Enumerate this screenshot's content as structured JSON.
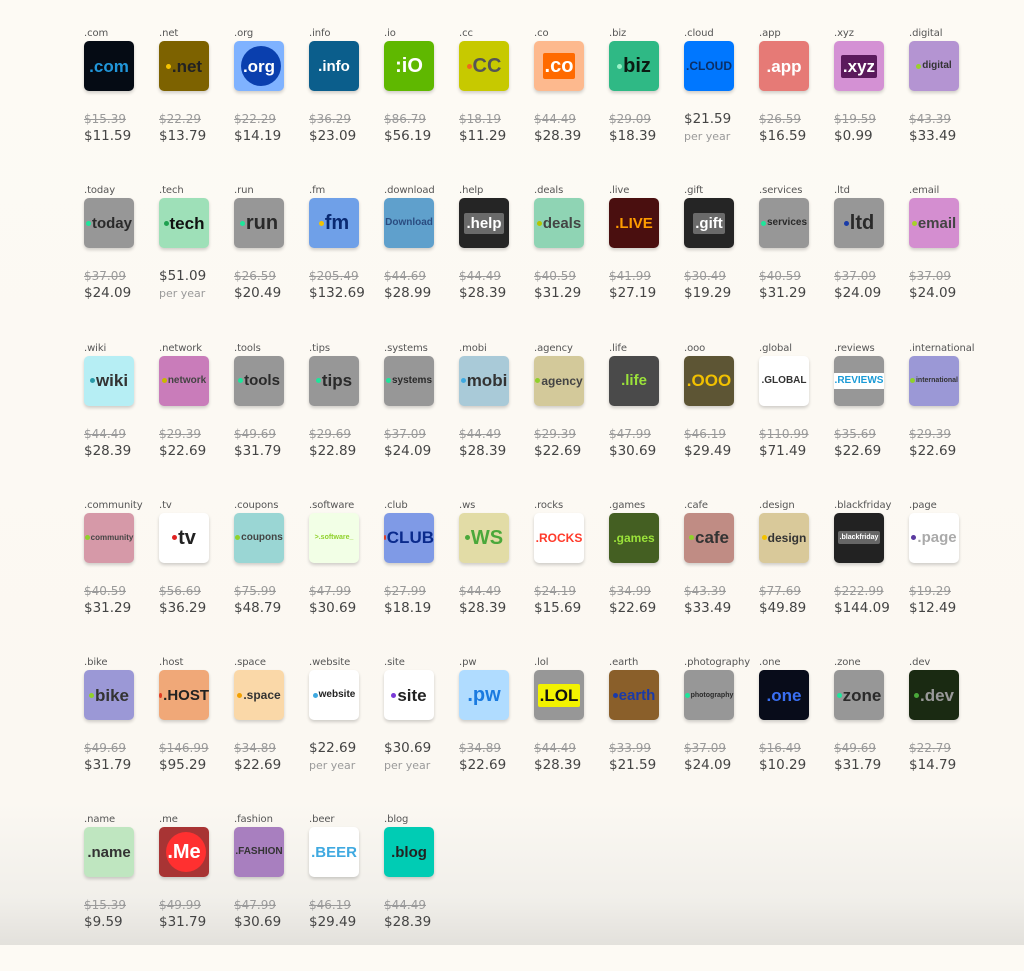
{
  "domains": [
    {
      "tld": ".com",
      "tile_text": ".com",
      "bg": "#050b14",
      "fg": "#2196d9",
      "old": "$15.39",
      "new": "$11.59"
    },
    {
      "tld": ".net",
      "tile_text": ".net",
      "bg": "#7d6200",
      "fg": "#222222",
      "dot": "#f5c400",
      "old": "$22.29",
      "new": "$13.79"
    },
    {
      "tld": ".org",
      "tile_text": ".org",
      "bg": "#7fb2ff",
      "fg": "#ffffff",
      "circle": "#0a3fae",
      "old": "$22.29",
      "new": "$14.19"
    },
    {
      "tld": ".info",
      "tile_text": ".info",
      "bg": "#0b5e8c",
      "fg": "#ffffff",
      "old": "$36.29",
      "new": "$23.09"
    },
    {
      "tld": ".io",
      "tile_text": ":iO",
      "bg": "#5fb800",
      "fg": "#ffffff",
      "old": "$86.79",
      "new": "$56.19"
    },
    {
      "tld": ".cc",
      "tile_text": "CC",
      "bg": "#c7c900",
      "fg": "#555555",
      "dot": "#ee6a1b",
      "old": "$18.19",
      "new": "$11.29"
    },
    {
      "tld": ".co",
      "tile_text": ".co",
      "bg": "#fdb98e",
      "fg": "#ffffff",
      "inner": "#ff6a00",
      "old": "$44.49",
      "new": "$28.39"
    },
    {
      "tld": ".biz",
      "tile_text": "biz",
      "bg": "#2fb985",
      "fg": "#0b1b12",
      "dot": "#9af2c8",
      "old": "$29.09",
      "new": "$18.39"
    },
    {
      "tld": ".cloud",
      "tile_text": ".CLOUD",
      "bg": "#0077ff",
      "fg": "#0b2f66",
      "price": "$21.59",
      "per_year": "per year"
    },
    {
      "tld": ".app",
      "tile_text": ".app",
      "bg": "#e67a76",
      "fg": "#ffffff",
      "old": "$26.59",
      "new": "$16.59"
    },
    {
      "tld": ".xyz",
      "tile_text": ".xyz",
      "bg": "#d491d4",
      "fg": "#ffffff",
      "inner": "#5a1a5c",
      "old": "$19.59",
      "new": "$0.99"
    },
    {
      "tld": ".digital",
      "tile_text": "digital",
      "bg": "#b494d2",
      "fg": "#333333",
      "dot": "#9ad12b",
      "old": "$43.39",
      "new": "$33.49"
    },
    {
      "tld": ".today",
      "tile_text": "today",
      "bg": "#979797",
      "fg": "#2a2a2a",
      "dot": "#1ee59b",
      "old": "$37.09",
      "new": "$24.09"
    },
    {
      "tld": ".tech",
      "tile_text": "tech",
      "bg": "#9ee0b8",
      "fg": "#111111",
      "dot": "#1fa050",
      "price": "$51.09",
      "per_year": "per year"
    },
    {
      "tld": ".run",
      "tile_text": "run",
      "bg": "#979797",
      "fg": "#2a2a2a",
      "dot": "#1ee59b",
      "old": "$26.59",
      "new": "$20.49"
    },
    {
      "tld": ".fm",
      "tile_text": "fm",
      "bg": "#6fa0e8",
      "fg": "#0a2a73",
      "dot": "#f2c200",
      "old": "$205.49",
      "new": "$132.69"
    },
    {
      "tld": ".download",
      "tile_text": "Download",
      "bg": "#5fa0cc",
      "fg": "#2a4c80",
      "old": "$44.69",
      "new": "$28.99"
    },
    {
      "tld": ".help",
      "tile_text": ".help",
      "bg": "#252525",
      "fg": "#ffffff",
      "inner": "#6a6a6a",
      "old": "$44.49",
      "new": "$28.39"
    },
    {
      "tld": ".deals",
      "tile_text": "deals",
      "bg": "#8fd4b4",
      "fg": "#444444",
      "dot": "#b5c600",
      "old": "$40.59",
      "new": "$31.29"
    },
    {
      "tld": ".live",
      "tile_text": ".LIVE",
      "bg": "#4a0f0f",
      "fg": "#ff9d00",
      "old": "$41.99",
      "new": "$27.19"
    },
    {
      "tld": ".gift",
      "tile_text": ".gift",
      "bg": "#252525",
      "fg": "#ffffff",
      "inner": "#6a6a6a",
      "old": "$30.49",
      "new": "$19.29"
    },
    {
      "tld": ".services",
      "tile_text": "services",
      "bg": "#979797",
      "fg": "#2a2a2a",
      "dot": "#1ee59b",
      "old": "$40.59",
      "new": "$31.29"
    },
    {
      "tld": ".ltd",
      "tile_text": "ltd",
      "bg": "#979797",
      "fg": "#2a2a2a",
      "dot": "#1a3ca8",
      "old": "$37.09",
      "new": "$24.09"
    },
    {
      "tld": ".email",
      "tile_text": "email",
      "bg": "#d48ed0",
      "fg": "#444444",
      "dot": "#a6d12b",
      "old": "$37.09",
      "new": "$24.09"
    },
    {
      "tld": ".wiki",
      "tile_text": "wiki",
      "bg": "#b6eef4",
      "fg": "#333333",
      "dot": "#2a9aa8",
      "old": "$44.49",
      "new": "$28.39"
    },
    {
      "tld": ".network",
      "tile_text": "network",
      "bg": "#c97cba",
      "fg": "#444444",
      "dot": "#c9b800",
      "old": "$29.39",
      "new": "$22.69"
    },
    {
      "tld": ".tools",
      "tile_text": "tools",
      "bg": "#979797",
      "fg": "#2a2a2a",
      "dot": "#1ee59b",
      "old": "$49.69",
      "new": "$31.79"
    },
    {
      "tld": ".tips",
      "tile_text": "tips",
      "bg": "#979797",
      "fg": "#2a2a2a",
      "dot": "#1ee59b",
      "old": "$29.69",
      "new": "$22.89"
    },
    {
      "tld": ".systems",
      "tile_text": "systems",
      "bg": "#979797",
      "fg": "#2a2a2a",
      "dot": "#1ee59b",
      "old": "$37.09",
      "new": "$24.09"
    },
    {
      "tld": ".mobi",
      "tile_text": "mobi",
      "bg": "#a9cad8",
      "fg": "#333333",
      "dot": "#3fa9e0",
      "old": "$44.49",
      "new": "$28.39"
    },
    {
      "tld": ".agency",
      "tile_text": "agency",
      "bg": "#d3c99a",
      "fg": "#444444",
      "dot": "#8fd12b",
      "old": "$29.39",
      "new": "$22.69"
    },
    {
      "tld": ".life",
      "tile_text": ".life",
      "bg": "#4a4a4a",
      "fg": "#9be23a",
      "old": "$47.99",
      "new": "$30.69"
    },
    {
      "tld": ".ooo",
      "tile_text": ".OOO",
      "bg": "#5d5534",
      "fg": "#f1c000",
      "old": "$46.19",
      "new": "$29.49"
    },
    {
      "tld": ".global",
      "tile_text": ".GLOBAL",
      "bg": "#ffffff",
      "fg": "#333333",
      "old": "$110.99",
      "new": "$71.49"
    },
    {
      "tld": ".reviews",
      "tile_text": ".REVIEWS",
      "bg": "#979797",
      "fg": "#1a9ad6",
      "inner": "#ffffff",
      "old": "$35.69",
      "new": "$22.69"
    },
    {
      "tld": ".international",
      "tile_text": "international",
      "bg": "#9b98d6",
      "fg": "#333333",
      "dot": "#8fd12b",
      "old": "$29.39",
      "new": "$22.69"
    },
    {
      "tld": ".community",
      "tile_text": "community",
      "bg": "#d699a8",
      "fg": "#444444",
      "dot": "#8fd12b",
      "old": "$40.59",
      "new": "$31.29"
    },
    {
      "tld": ".tv",
      "tile_text": "tv",
      "bg": "#ffffff",
      "fg": "#222222",
      "dot": "#e02222",
      "old": "$56.69",
      "new": "$36.29"
    },
    {
      "tld": ".coupons",
      "tile_text": "coupons",
      "bg": "#9ad6d4",
      "fg": "#444444",
      "dot": "#8fd12b",
      "old": "$75.99",
      "new": "$48.79"
    },
    {
      "tld": ".software",
      "tile_text": ">.software_",
      "bg": "#f2ffe6",
      "fg": "#8fd12b",
      "old": "$47.99",
      "new": "$30.69"
    },
    {
      "tld": ".club",
      "tile_text": "CLUB",
      "bg": "#7f9ae6",
      "fg": "#0a2a8c",
      "dot": "#e03a22",
      "old": "$27.99",
      "new": "$18.19"
    },
    {
      "tld": ".ws",
      "tile_text": "WS",
      "bg": "#e2dca6",
      "fg": "#4aa83a",
      "dot": "#4aa83a",
      "old": "$44.49",
      "new": "$28.39"
    },
    {
      "tld": ".rocks",
      "tile_text": ".ROCKS",
      "bg": "#ffffff",
      "fg": "#ff3a2a",
      "old": "$24.19",
      "new": "$15.69"
    },
    {
      "tld": ".games",
      "tile_text": ".games",
      "bg": "#445f22",
      "fg": "#9be23a",
      "old": "$34.99",
      "new": "$22.69"
    },
    {
      "tld": ".cafe",
      "tile_text": "cafe",
      "bg": "#c08c84",
      "fg": "#333333",
      "dot": "#8fd12b",
      "old": "$43.39",
      "new": "$33.49"
    },
    {
      "tld": ".design",
      "tile_text": "design",
      "bg": "#d9c99a",
      "fg": "#333333",
      "dot": "#f2c200",
      "old": "$77.69",
      "new": "$49.89"
    },
    {
      "tld": ".blackfriday",
      "tile_text": ".blackfriday",
      "bg": "#222222",
      "fg": "#ffffff",
      "inner": "#666666",
      "old": "$222.99",
      "new": "$144.09"
    },
    {
      "tld": ".page",
      "tile_text": ".page",
      "bg": "#ffffff",
      "fg": "#aaaaaa",
      "dot": "#5a3aa0",
      "old": "$19.29",
      "new": "$12.49"
    },
    {
      "tld": ".bike",
      "tile_text": "bike",
      "bg": "#9b98d6",
      "fg": "#333333",
      "dot": "#8fd12b",
      "old": "$49.69",
      "new": "$31.79"
    },
    {
      "tld": ".host",
      "tile_text": ".HOST",
      "bg": "#f0a878",
      "fg": "#222222",
      "dot": "#e03a22",
      "old": "$146.99",
      "new": "$95.29"
    },
    {
      "tld": ".space",
      "tile_text": ".space",
      "bg": "#fad8a8",
      "fg": "#333333",
      "dot": "#f2a000",
      "old": "$34.89",
      "new": "$22.69"
    },
    {
      "tld": ".website",
      "tile_text": "website",
      "bg": "#ffffff",
      "fg": "#222222",
      "dot": "#3fa9e0",
      "price": "$22.69",
      "per_year": "per year"
    },
    {
      "tld": ".site",
      "tile_text": "site",
      "bg": "#ffffff",
      "fg": "#222222",
      "dot": "#7a3ad6",
      "price": "$30.69",
      "per_year": "per year"
    },
    {
      "tld": ".pw",
      "tile_text": ".pw",
      "bg": "#b0dcff",
      "fg": "#1a7ae0",
      "old": "$34.89",
      "new": "$22.69"
    },
    {
      "tld": ".lol",
      "tile_text": ".LOL",
      "bg": "#979797",
      "fg": "#111111",
      "inner": "#f2f200",
      "old": "$44.49",
      "new": "$28.39"
    },
    {
      "tld": ".earth",
      "tile_text": "earth",
      "bg": "#8a5f2a",
      "fg": "#1a3aa8",
      "dot": "#1a3aa8",
      "old": "$33.99",
      "new": "$21.59"
    },
    {
      "tld": ".photography",
      "tile_text": "photography",
      "bg": "#979797",
      "fg": "#2a2a2a",
      "dot": "#1ee59b",
      "old": "$37.09",
      "new": "$24.09"
    },
    {
      "tld": ".one",
      "tile_text": ".one",
      "bg": "#080c1a",
      "fg": "#3a6ff2",
      "old": "$16.49",
      "new": "$10.29"
    },
    {
      "tld": ".zone",
      "tile_text": "zone",
      "bg": "#979797",
      "fg": "#2a2a2a",
      "dot": "#1ee59b",
      "old": "$49.69",
      "new": "$31.79"
    },
    {
      "tld": ".dev",
      "tile_text": ".dev",
      "bg": "#1a2a12",
      "fg": "#999999",
      "dot": "#4aa83a",
      "old": "$22.79",
      "new": "$14.79"
    },
    {
      "tld": ".name",
      "tile_text": ".name",
      "bg": "#bfe6c0",
      "fg": "#333333",
      "old": "$15.39",
      "new": "$9.59"
    },
    {
      "tld": ".me",
      "tile_text": ".Me",
      "bg": "#a83434",
      "fg": "#ffffff",
      "circle": "#ff3030",
      "old": "$49.99",
      "new": "$31.79"
    },
    {
      "tld": ".fashion",
      "tile_text": ".FASHION",
      "bg": "#a87fbf",
      "fg": "#333333",
      "old": "$47.99",
      "new": "$30.69"
    },
    {
      "tld": ".beer",
      "tile_text": ".BEER",
      "bg": "#ffffff",
      "fg": "#3fa9e0",
      "old": "$46.19",
      "new": "$29.49"
    },
    {
      "tld": ".blog",
      "tile_text": ".blog",
      "bg": "#00ccb4",
      "fg": "#222222",
      "old": "$44.49",
      "new": "$28.39"
    }
  ]
}
